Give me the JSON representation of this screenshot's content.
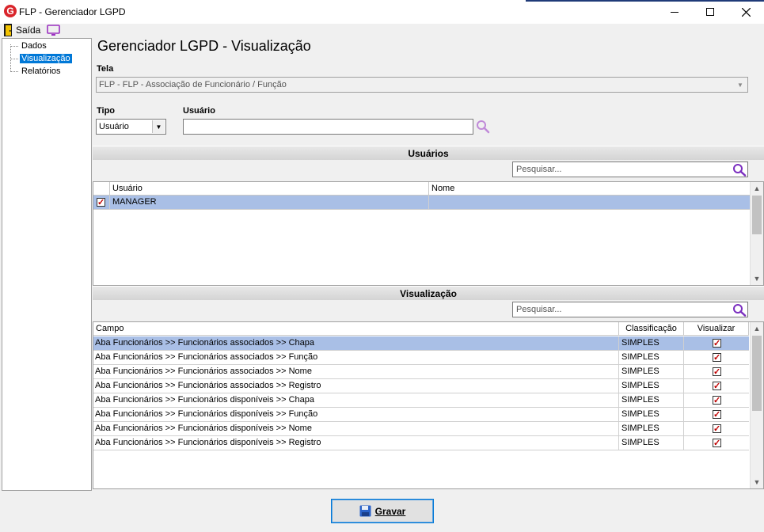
{
  "window": {
    "title": "FLP - Gerenciador LGPD",
    "minimize_icon": "minimize-icon",
    "maximize_icon": "maximize-icon",
    "close_icon": "close-icon"
  },
  "menubar": {
    "exit_label": "Saída",
    "exit_icon": "door-exit-icon",
    "monitor_icon": "monitor-icon"
  },
  "tree": {
    "items": [
      {
        "label": "Dados",
        "selected": false
      },
      {
        "label": "Visualização",
        "selected": true
      },
      {
        "label": "Relatórios",
        "selected": false
      }
    ]
  },
  "page": {
    "title": "Gerenciador LGPD - Visualização"
  },
  "form": {
    "tela_label": "Tela",
    "tela_value": "FLP - FLP - Associação de Funcionário / Função",
    "tipo_label": "Tipo",
    "tipo_value": "Usuário",
    "usuario_label": "Usuário",
    "usuario_value": ""
  },
  "users_section": {
    "header": "Usuários",
    "search_placeholder": "Pesquisar...",
    "columns": [
      "Usuário",
      "Nome"
    ],
    "rows": [
      {
        "checked": true,
        "usuario": "MANAGER",
        "nome": ""
      }
    ]
  },
  "view_section": {
    "header": "Visualização",
    "search_placeholder": "Pesquisar...",
    "columns": [
      "Campo",
      "Classificação",
      "Visualizar"
    ],
    "rows": [
      {
        "campo": "Aba Funcionários >> Funcionários associados >> Chapa",
        "classificacao": "SIMPLES",
        "visualizar": true
      },
      {
        "campo": "Aba Funcionários >> Funcionários associados >> Função",
        "classificacao": "SIMPLES",
        "visualizar": true
      },
      {
        "campo": "Aba Funcionários >> Funcionários associados >> Nome",
        "classificacao": "SIMPLES",
        "visualizar": true
      },
      {
        "campo": "Aba Funcionários >> Funcionários associados >> Registro",
        "classificacao": "SIMPLES",
        "visualizar": true
      },
      {
        "campo": "Aba Funcionários >> Funcionários disponíveis >> Chapa",
        "classificacao": "SIMPLES",
        "visualizar": true
      },
      {
        "campo": "Aba Funcionários >> Funcionários disponíveis >> Função",
        "classificacao": "SIMPLES",
        "visualizar": true
      },
      {
        "campo": "Aba Funcionários >> Funcionários disponíveis >> Nome",
        "classificacao": "SIMPLES",
        "visualizar": true
      },
      {
        "campo": "Aba Funcionários >> Funcionários disponíveis >> Registro",
        "classificacao": "SIMPLES",
        "visualizar": true
      }
    ]
  },
  "footer": {
    "save_label": "Gravar",
    "save_icon": "floppy-disk-icon"
  },
  "colors": {
    "selection_row": "#a9bfe6",
    "tree_selection": "#0078d7",
    "search_icon": "#7b2fbf",
    "app_logo": "#d9262c"
  }
}
